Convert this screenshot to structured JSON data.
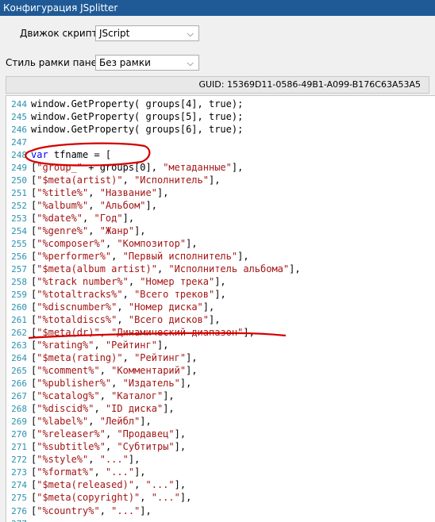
{
  "window": {
    "title": "Конфигурация JSplitter"
  },
  "settings": {
    "engine": {
      "label": "Движок скрипта:",
      "value": "JScript"
    },
    "frame_style": {
      "label": "Стиль рамки панели:",
      "value": "Без рамки"
    },
    "guid": "GUID: 15369D11-0586-49B1-A099-B176C63A53A5"
  },
  "code": {
    "lines": [
      {
        "no": "244",
        "text": "window.GetProperty( groups[4], true);"
      },
      {
        "no": "245",
        "text": "window.GetProperty( groups[5], true);"
      },
      {
        "no": "246",
        "text": "window.GetProperty( groups[6], true);"
      },
      {
        "no": "247",
        "text": ""
      },
      {
        "no": "248",
        "kw": "var",
        "text": " tfname = ["
      },
      {
        "no": "249",
        "text": "[\"group_\" + groups[0], \"метаданные\"],"
      },
      {
        "no": "250",
        "text": "[\"$meta(artist)\", \"Исполнитель\"],"
      },
      {
        "no": "251",
        "text": "[\"%title%\", \"Название\"],"
      },
      {
        "no": "252",
        "text": "[\"%album%\", \"Альбом\"],"
      },
      {
        "no": "253",
        "text": "[\"%date%\", \"Год\"],"
      },
      {
        "no": "254",
        "text": "[\"%genre%\", \"Жанр\"],"
      },
      {
        "no": "255",
        "text": "[\"%composer%\", \"Композитор\"],"
      },
      {
        "no": "256",
        "text": "[\"%performer%\", \"Первый исполнитель\"],"
      },
      {
        "no": "257",
        "text": "[\"$meta(album artist)\", \"Исполнитель альбома\"],"
      },
      {
        "no": "258",
        "text": "[\"%track number%\", \"Номер трека\"],"
      },
      {
        "no": "259",
        "text": "[\"%totaltracks%\", \"Всего треков\"],"
      },
      {
        "no": "260",
        "text": "[\"%discnumber%\", \"Номер диска\"],"
      },
      {
        "no": "261",
        "text": "[\"%totaldiscs%\", \"Всего дисков\"],"
      },
      {
        "no": "262",
        "text": "[\"$meta(dr)\", \"Динамический диапазон\"],"
      },
      {
        "no": "263",
        "text": "[\"%rating%\", \"Рейтинг\"],"
      },
      {
        "no": "264",
        "text": "[\"$meta(rating)\", \"Рейтинг\"],"
      },
      {
        "no": "265",
        "text": "[\"%comment%\", \"Комментарий\"],"
      },
      {
        "no": "266",
        "text": "[\"%publisher%\", \"Издатель\"],"
      },
      {
        "no": "267",
        "text": "[\"%catalog%\", \"Каталог\"],"
      },
      {
        "no": "268",
        "text": "[\"%discid%\", \"ID диска\"],"
      },
      {
        "no": "269",
        "text": "[\"%label%\", \"Лейбл\"],"
      },
      {
        "no": "270",
        "text": "[\"%releaser%\", \"Продавец\"],"
      },
      {
        "no": "271",
        "text": "[\"%subtitle%\", \"Субтитры\"],"
      },
      {
        "no": "272",
        "text": "[\"%style%\", \"...\"],"
      },
      {
        "no": "273",
        "text": "[\"%format%\", \"...\"],"
      },
      {
        "no": "274",
        "text": "[\"$meta(released)\", \"...\"],"
      },
      {
        "no": "275",
        "text": "[\"$meta(copyright)\", \"...\"],"
      },
      {
        "no": "276",
        "text": "[\"%country%\", \"...\"],"
      },
      {
        "no": "277",
        "text": ""
      }
    ]
  }
}
